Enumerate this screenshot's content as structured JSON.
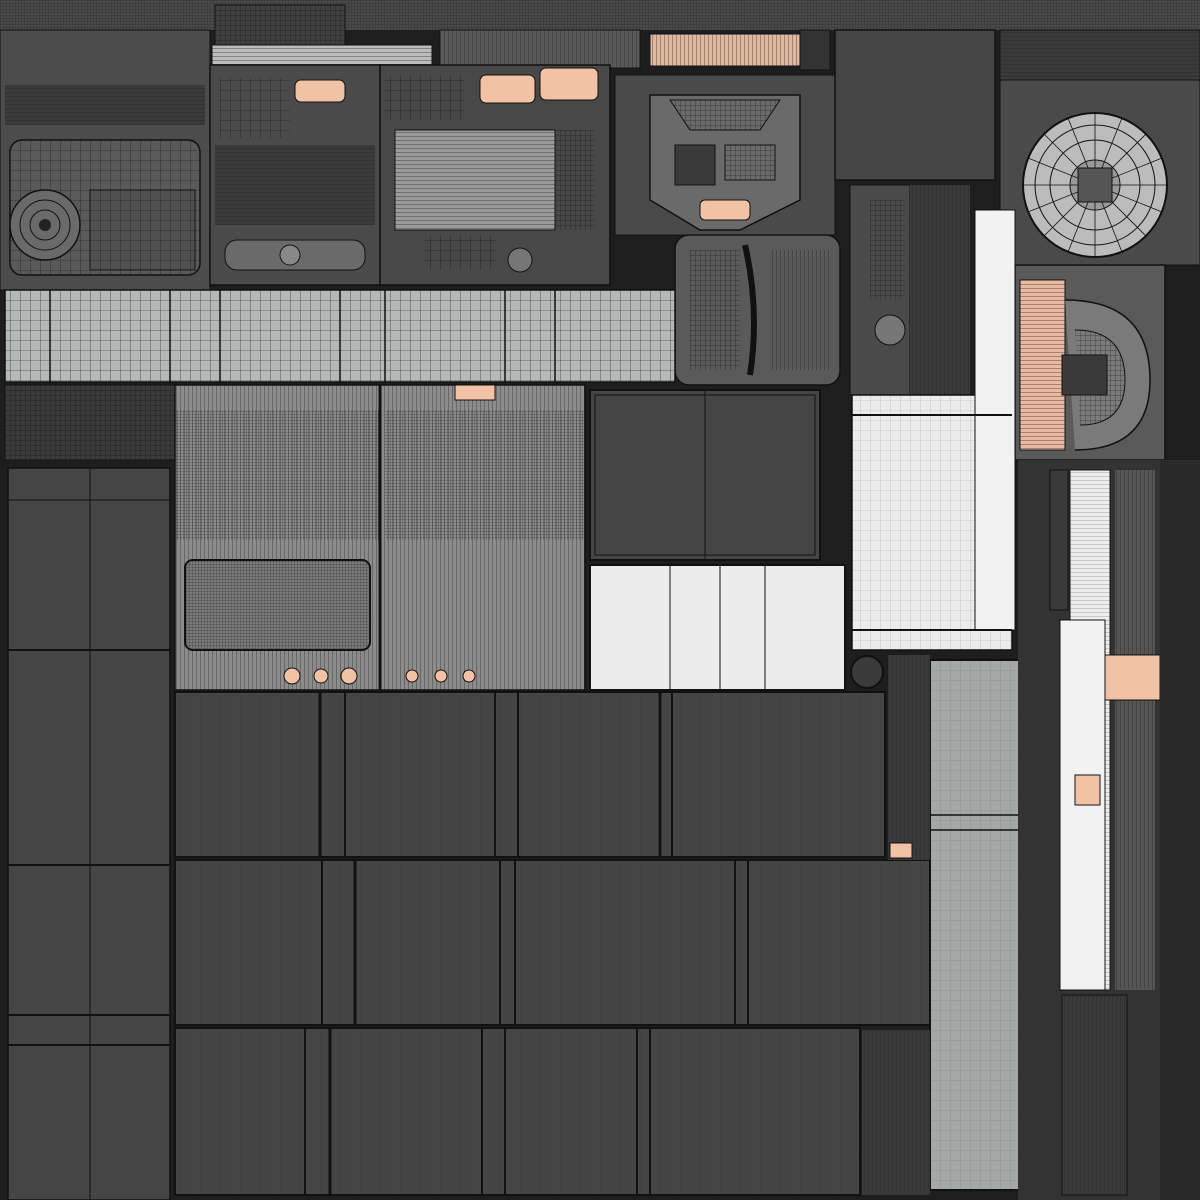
{
  "texture": {
    "palette": {
      "background": "#1e1e1e",
      "panel_dark": "#454545",
      "panel_mid": "#8c8c8c",
      "panel_light": "#b4b8b6",
      "panel_white": "#ececec",
      "wire": "#111111",
      "wire_light": "#5a5a5a",
      "accent_copper": "#f2c2a6"
    },
    "icons": [
      "fan-grille-icon",
      "speaker-grille-icon",
      "port-ring-icon"
    ]
  }
}
